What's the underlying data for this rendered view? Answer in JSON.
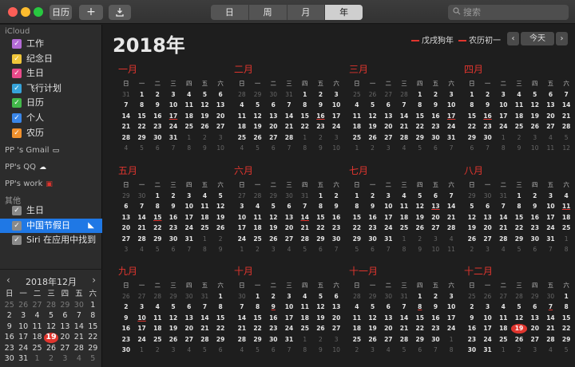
{
  "toolbar": {
    "calendars_label": "日历",
    "add_label": "+",
    "views": [
      "日",
      "周",
      "月",
      "年"
    ],
    "active_view": "年",
    "search_placeholder": "搜索"
  },
  "sidebar": {
    "icloud_label": "iCloud",
    "icloud_calendars": [
      {
        "label": "工作",
        "color": "#b46bd6"
      },
      {
        "label": "纪念日",
        "color": "#f0c63a"
      },
      {
        "label": "生日",
        "color": "#e84a8a"
      },
      {
        "label": "飞行计划",
        "color": "#36a3d9"
      },
      {
        "label": "日历",
        "color": "#42b84a"
      },
      {
        "label": "个人",
        "color": "#3a86e8"
      },
      {
        "label": "农历",
        "color": "#f0912e"
      }
    ],
    "accounts": [
      {
        "label": "PP 's Gmail"
      },
      {
        "label": "PP's QQ"
      },
      {
        "label": "PP's work"
      }
    ],
    "other_label": "其他",
    "other_calendars": [
      {
        "label": "生日",
        "color": "#8a8a8a",
        "selected": false
      },
      {
        "label": "中国节假日",
        "color": "#8a8a8a",
        "selected": true
      },
      {
        "label": "Siri 在应用中找到",
        "color": "#8a8a8a",
        "selected": false
      }
    ]
  },
  "mini_calendar": {
    "title": "2018年12月",
    "prev": "‹",
    "next": "›",
    "weekdays": [
      "日",
      "一",
      "二",
      "三",
      "四",
      "五",
      "六"
    ],
    "lead": [
      25,
      26,
      27,
      28,
      29,
      30
    ],
    "days_in_month": 31,
    "today": 19,
    "trail": [
      1,
      2,
      3,
      4,
      5
    ]
  },
  "main": {
    "year_title": "2018年",
    "legend": [
      "戊戌狗年",
      "农历初一"
    ],
    "today_label": "今天",
    "prev": "‹",
    "next": "›",
    "weekdays": [
      "日",
      "一",
      "二",
      "三",
      "四",
      "五",
      "六"
    ],
    "months": [
      {
        "name": "一月",
        "first_weekday": 1,
        "days": 31,
        "holidays": [
          17
        ]
      },
      {
        "name": "二月",
        "first_weekday": 4,
        "days": 28,
        "holidays": [
          16
        ]
      },
      {
        "name": "三月",
        "first_weekday": 4,
        "days": 31,
        "holidays": [
          17
        ]
      },
      {
        "name": "四月",
        "first_weekday": 0,
        "days": 30,
        "holidays": [
          16
        ]
      },
      {
        "name": "五月",
        "first_weekday": 2,
        "days": 31,
        "holidays": [
          15
        ]
      },
      {
        "name": "六月",
        "first_weekday": 5,
        "days": 30,
        "holidays": [
          14
        ]
      },
      {
        "name": "七月",
        "first_weekday": 0,
        "days": 31,
        "holidays": [
          13
        ]
      },
      {
        "name": "八月",
        "first_weekday": 3,
        "days": 31,
        "holidays": [
          11
        ]
      },
      {
        "name": "九月",
        "first_weekday": 6,
        "days": 30,
        "holidays": [
          10
        ]
      },
      {
        "name": "十月",
        "first_weekday": 1,
        "days": 31,
        "holidays": [
          9
        ]
      },
      {
        "name": "十一月",
        "first_weekday": 4,
        "days": 30,
        "holidays": [
          8
        ]
      },
      {
        "name": "十二月",
        "first_weekday": 6,
        "days": 31,
        "holidays": [
          7
        ],
        "today": 19
      }
    ]
  }
}
